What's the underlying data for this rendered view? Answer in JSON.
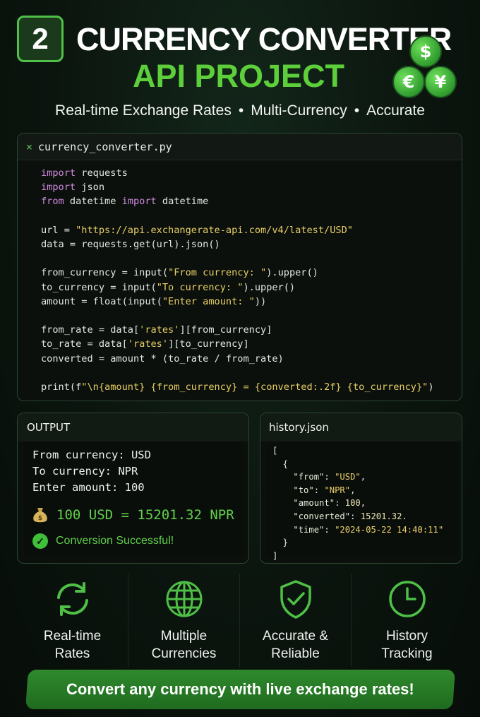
{
  "header": {
    "badge_number": "2",
    "title_line1": "CURRENCY CONVERTER",
    "title_line2": "API PROJECT",
    "coins": [
      "$",
      "€",
      "¥"
    ],
    "subtitle_parts": [
      "Real-time Exchange Rates",
      "Multi-Currency",
      "Accurate"
    ],
    "separator": "•"
  },
  "code_panel": {
    "close_glyph": "×",
    "filename": "currency_converter.py",
    "lines": [
      "import requests",
      "import json",
      "from datetime import datetime",
      "",
      "url = \"https://api.exchangerate-api.com/v4/latest/USD\"",
      "data = requests.get(url).json()",
      "",
      "from_currency = input(\"From currency: \").upper()",
      "to_currency = input(\"To currency: \").upper()",
      "amount = float(input(\"Enter amount: \"))",
      "",
      "from_rate = data['rates'][from_currency]",
      "to_rate = data['rates'][to_currency]",
      "converted = amount * (to_rate / from_rate)",
      "",
      "print(f\"\\n{amount} {from_currency} = {converted:.2f} {to_currency}\")"
    ]
  },
  "output_panel": {
    "title": "OUTPUT",
    "lines": [
      "From currency: USD",
      "To currency: NPR",
      "Enter amount: 100"
    ],
    "result": "100 USD = 15201.32 NPR",
    "success": "Conversion Successful!"
  },
  "history_panel": {
    "title": "history.json",
    "entry": {
      "from": "\"USD\"",
      "to": "\"NPR\"",
      "amount": "100",
      "converted": "15201.32.",
      "time": "\"2024-05-22 14:40:11\""
    }
  },
  "features": [
    {
      "icon": "refresh-icon",
      "label": "Real-time\nRates"
    },
    {
      "icon": "globe-icon",
      "label": "Multiple\nCurrencies"
    },
    {
      "icon": "shield-check-icon",
      "label": "Accurate &\nReliable"
    },
    {
      "icon": "clock-icon",
      "label": "History\nTracking"
    }
  ],
  "cta": "Convert any currency with live exchange rates!",
  "colors": {
    "accent_green": "#5ccf3a",
    "background": "#0b150e",
    "keyword": "#d08adf",
    "string": "#e8cf63"
  }
}
